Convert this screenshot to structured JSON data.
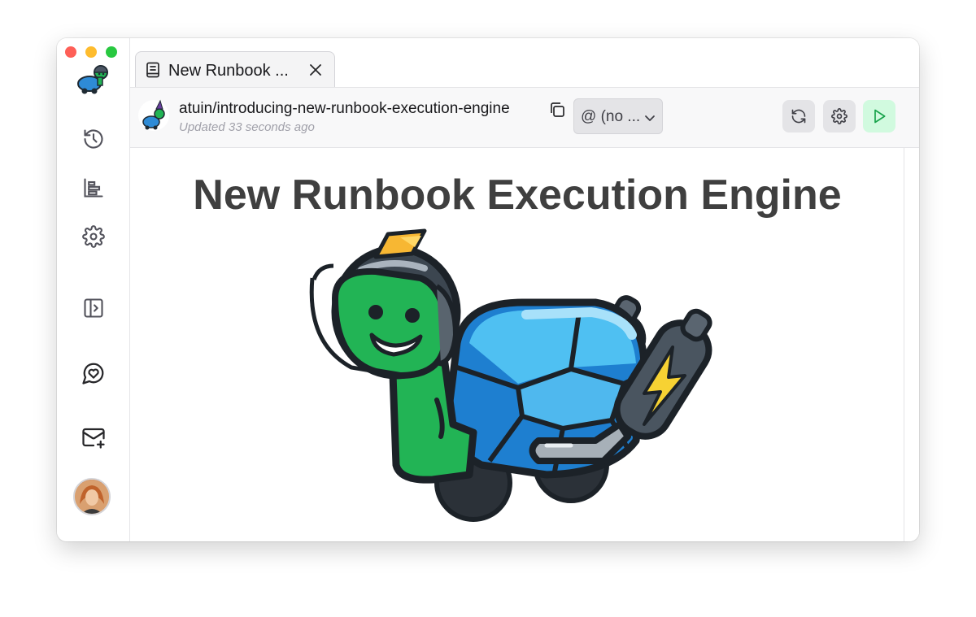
{
  "window": {
    "traffic_lights": [
      "close",
      "minimize",
      "zoom"
    ]
  },
  "sidebar": {
    "logo_icon": "turtle-logo-icon",
    "items": [
      {
        "name": "history",
        "icon": "history-icon"
      },
      {
        "name": "stats",
        "icon": "chart-icon"
      },
      {
        "name": "settings",
        "icon": "gear-icon"
      },
      {
        "name": "toggle-panel",
        "icon": "panel-toggle-icon"
      },
      {
        "name": "feedback",
        "icon": "chat-heart-icon"
      },
      {
        "name": "invite",
        "icon": "mail-plus-icon"
      }
    ],
    "avatar": "user-avatar"
  },
  "tabs": [
    {
      "label": "New Runbook ...",
      "icon": "notebook-icon",
      "active": true
    }
  ],
  "toolbar": {
    "runbook_title": "atuin/introducing-new-runbook-execution-engine",
    "updated_text": "Updated 33 seconds ago",
    "environment_selected": "@ (no ...",
    "buttons": [
      "refresh",
      "settings",
      "run"
    ]
  },
  "document": {
    "heading": "New Runbook Execution Engine",
    "hero_image": "atuin-turtle-jetpack-illustration"
  },
  "colors": {
    "run_button_bg": "#d1fadf",
    "run_icon": "#16a34a",
    "heading": "#3f3f3f"
  }
}
